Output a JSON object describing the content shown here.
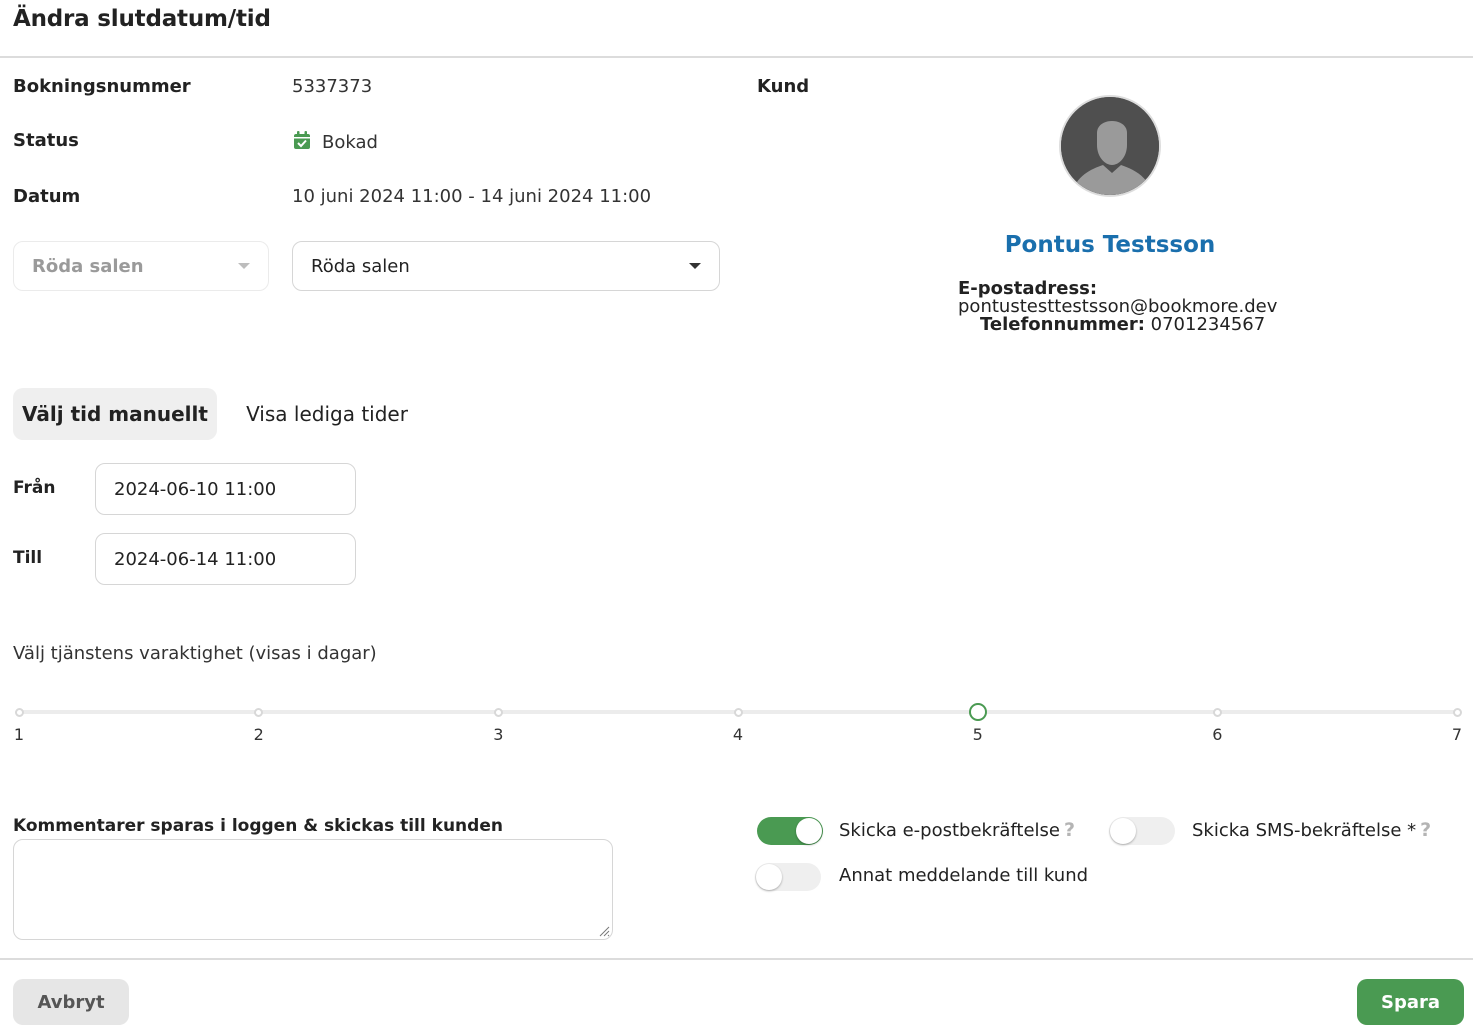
{
  "dialog": {
    "title": "Ändra slutdatum/tid"
  },
  "details": {
    "booking_number_label": "Bokningsnummer",
    "booking_number": "5337373",
    "status_label": "Status",
    "status": "Bokad",
    "date_label": "Datum",
    "date": "10 juni 2024 11:00 - 14 juni 2024 11:00",
    "resource_select_disabled": "Röda salen",
    "resource_select": "Röda salen"
  },
  "customer": {
    "label": "Kund",
    "name": "Pontus Testsson",
    "email_label": "E-postadress:",
    "email": "pontustesttestsson@bookmore.dev",
    "phone_label": "Telefonnummer:",
    "phone": "0701234567"
  },
  "tabs": [
    {
      "label": "Välj tid manuellt",
      "active": true
    },
    {
      "label": "Visa lediga tider",
      "active": false
    }
  ],
  "time": {
    "from_label": "Från",
    "from_value": "2024-06-10 11:00",
    "to_label": "Till",
    "to_value": "2024-06-14 11:00"
  },
  "duration": {
    "label": "Välj tjänstens varaktighet (visas i dagar)",
    "ticks": [
      "1",
      "2",
      "3",
      "4",
      "5",
      "6",
      "7"
    ],
    "selected": 5
  },
  "comments": {
    "label": "Kommentarer sparas i loggen & skickas till kunden",
    "value": ""
  },
  "notifications": {
    "email_confirm": {
      "label": "Skicka e-postbekräftelse",
      "on": true
    },
    "sms_confirm": {
      "label": "Skicka SMS-bekräftelse *",
      "on": false
    },
    "other_message": {
      "label": "Annat meddelande till kund",
      "on": false
    }
  },
  "footer": {
    "cancel_label": "Avbryt",
    "save_label": "Spara"
  },
  "colors": {
    "accent_green": "#4a9a52",
    "customer_link": "#1a6fad"
  }
}
